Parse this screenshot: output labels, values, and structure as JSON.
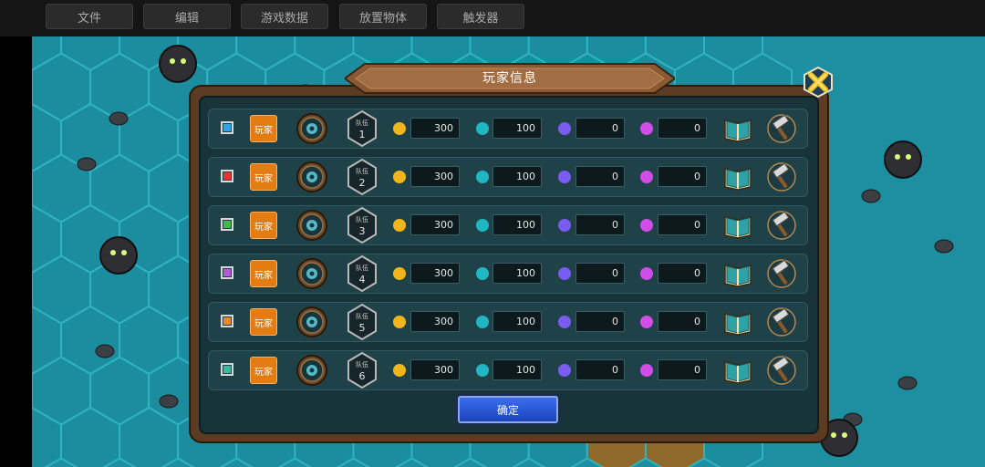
{
  "menu": {
    "items": [
      "文件",
      "编辑",
      "游戏数据",
      "放置物体",
      "触发器"
    ]
  },
  "dialog": {
    "title": "玩家信息",
    "confirm_label": "确定",
    "team_label": "队伍",
    "player_label": "玩家",
    "rows": [
      {
        "color": "#2aa6e8",
        "team": "1",
        "gold": "300",
        "food": "100",
        "mana": "0",
        "magic": "0",
        "emblem": "sun-emblem-icon"
      },
      {
        "color": "#e0392e",
        "team": "2",
        "gold": "300",
        "food": "100",
        "mana": "0",
        "magic": "0",
        "emblem": "skull-emblem-icon"
      },
      {
        "color": "#43b84a",
        "team": "3",
        "gold": "300",
        "food": "100",
        "mana": "0",
        "magic": "0",
        "emblem": "gear-emblem-icon"
      },
      {
        "color": "#b35ad6",
        "team": "4",
        "gold": "300",
        "food": "100",
        "mana": "0",
        "magic": "0",
        "emblem": "beast-emblem-icon"
      },
      {
        "color": "#e98a22",
        "team": "5",
        "gold": "300",
        "food": "100",
        "mana": "0",
        "magic": "0",
        "emblem": "wing-emblem-icon"
      },
      {
        "color": "#3cb9a0",
        "team": "6",
        "gold": "300",
        "food": "100",
        "mana": "0",
        "magic": "0",
        "emblem": "paw-emblem-icon"
      }
    ]
  },
  "colors": {
    "gold_icon": "#f2b51b",
    "food_icon": "#1fb7c4",
    "mana_icon": "#7a5cf0",
    "magic_icon": "#d04de8",
    "accent": "#e37c13"
  }
}
